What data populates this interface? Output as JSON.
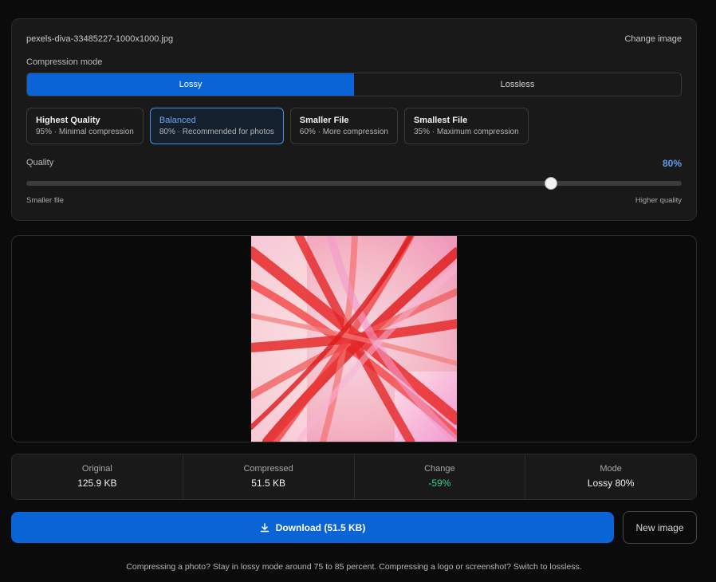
{
  "file": {
    "name": "pexels-diva-33485227-1000x1000.jpg",
    "change_label": "Change image"
  },
  "compression": {
    "label": "Compression mode",
    "modes": [
      {
        "label": "Lossy",
        "active": true
      },
      {
        "label": "Lossless",
        "active": false
      }
    ]
  },
  "presets": [
    {
      "title": "Highest Quality",
      "sub": "95% · Minimal compression",
      "active": false
    },
    {
      "title": "Balanced",
      "sub": "80% · Recommended for photos",
      "active": true
    },
    {
      "title": "Smaller File",
      "sub": "60% · More compression",
      "active": false
    },
    {
      "title": "Smallest File",
      "sub": "35% · Maximum compression",
      "active": false
    }
  ],
  "quality": {
    "label": "Quality",
    "value_text": "80%",
    "value": 80,
    "left_label": "Smaller file",
    "right_label": "Higher quality"
  },
  "stats": [
    {
      "label": "Original",
      "value": "125.9 KB"
    },
    {
      "label": "Compressed",
      "value": "51.5 KB"
    },
    {
      "label": "Change",
      "value": "-59%"
    },
    {
      "label": "Mode",
      "value": "Lossy 80%"
    }
  ],
  "actions": {
    "download_label": "Download (51.5 KB)",
    "new_image_label": "New image"
  },
  "hint": "Compressing a photo? Stay in lossy mode around 75 to 85 percent. Compressing a logo or screenshot? Switch to lossless.",
  "colors": {
    "accent": "#0b64d6",
    "positive": "#3fcf86",
    "background": "#0b0b0b",
    "panel": "#191919"
  },
  "icons": {
    "download": "download-icon"
  }
}
